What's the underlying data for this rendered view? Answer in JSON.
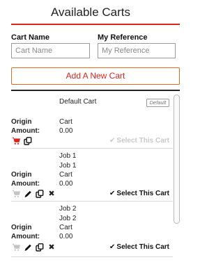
{
  "header": {
    "title": "Available Carts"
  },
  "form": {
    "cart_name_label": "Cart Name",
    "cart_name_placeholder": "Cart Name",
    "cart_name_value": "",
    "reference_label": "My Reference",
    "reference_placeholder": "My Reference",
    "reference_value": "",
    "add_button_label": "Add A New Cart"
  },
  "colors": {
    "accent": "#d9231d",
    "button_border": "#e06a1c",
    "disabled": "#c8c8c8"
  },
  "labels": {
    "origin": "Origin",
    "amount": "Amount:"
  },
  "carts": [
    {
      "name": "Default Cart",
      "reference": "",
      "badge": "Default",
      "origin": "Cart",
      "amount": "0.00",
      "select_label": "Select This Cart",
      "select_enabled": false,
      "icons": [
        "cart-icon",
        "copy-icon"
      ]
    },
    {
      "name": "Job 1",
      "reference": "Job 1",
      "badge": "",
      "origin": "Cart",
      "amount": "0.00",
      "select_label": "Select This Cart",
      "select_enabled": true,
      "icons": [
        "cart-icon",
        "pencil-icon",
        "copy-icon",
        "delete-icon"
      ]
    },
    {
      "name": "Job 2",
      "reference": "Job 2",
      "badge": "",
      "origin": "Cart",
      "amount": "0.00",
      "select_label": "Select This Cart",
      "select_enabled": true,
      "icons": [
        "cart-icon",
        "pencil-icon",
        "copy-icon",
        "delete-icon"
      ]
    }
  ]
}
